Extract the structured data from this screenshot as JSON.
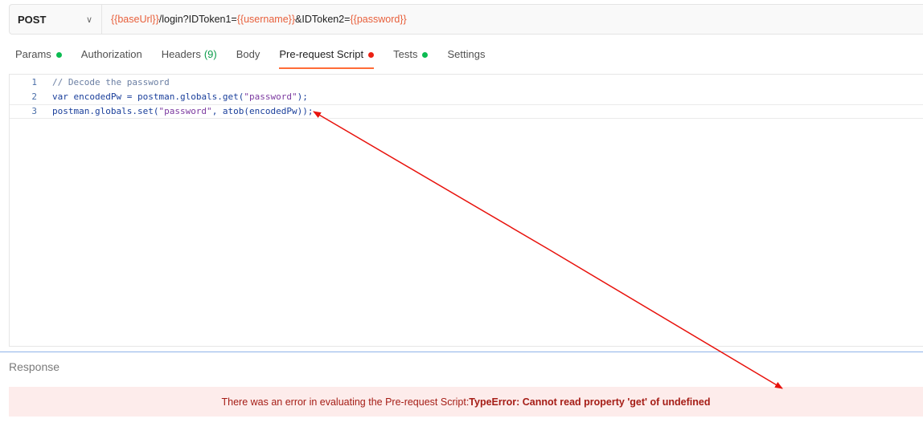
{
  "request": {
    "method": "POST",
    "url_parts": {
      "base_var": "{{baseUrl}}",
      "path": "/login?IDToken1=",
      "user_var": "{{username}}",
      "mid": "&IDToken2=",
      "pass_var": "{{password}}"
    }
  },
  "tabs": [
    {
      "label": "Params",
      "dot": "green"
    },
    {
      "label": "Authorization"
    },
    {
      "label": "Headers",
      "count": "(9)"
    },
    {
      "label": "Body"
    },
    {
      "label": "Pre-request Script",
      "dot": "red",
      "active": true
    },
    {
      "label": "Tests",
      "dot": "green"
    },
    {
      "label": "Settings"
    }
  ],
  "editor": {
    "lines": [
      {
        "num": "1",
        "comment": "// Decode the password"
      },
      {
        "num": "2",
        "kw": "var",
        "rest_a": " encodedPw = ",
        "id": "postman.globals.get(",
        "str": "\"password\"",
        "rest_b": ");"
      },
      {
        "num": "3",
        "a": "postman.globals.set(",
        "str": "\"password\"",
        "b": ", atob(encodedPw));"
      }
    ]
  },
  "response": {
    "title": "Response",
    "error_prefix": "There was an error in evaluating the Pre-request Script:",
    "error_detail": "TypeError: Cannot read property 'get' of undefined"
  },
  "colors": {
    "variable": "#e8603c",
    "active_tab_underline": "#ff6c37",
    "status_green": "#0cbb52",
    "status_red": "#eb2013",
    "error_text": "#a51d16",
    "error_bg": "#fdeceb",
    "annotation_arrow": "#e8120c"
  },
  "icons": {
    "method_dropdown": "chevron-down-icon"
  }
}
